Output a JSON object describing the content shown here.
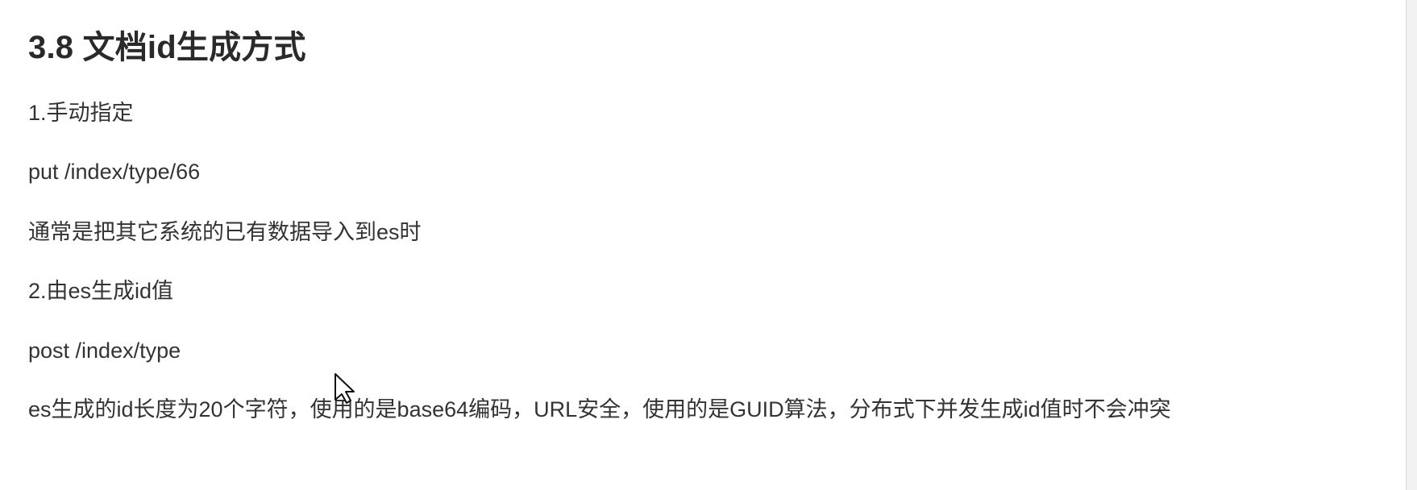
{
  "document": {
    "heading": "3.8 文档id生成方式",
    "paragraphs": [
      "1.手动指定",
      "put /index/type/66",
      "通常是把其它系统的已有数据导入到es时",
      "2.由es生成id值",
      "post /index/type",
      "es生成的id长度为20个字符，使用的是base64编码，URL安全，使用的是GUID算法，分布式下并发生成id值时不会冲突"
    ]
  },
  "ui": {
    "cursor_icon": "mouse-pointer-icon"
  }
}
